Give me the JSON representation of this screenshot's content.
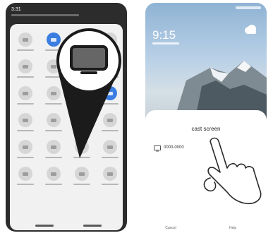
{
  "left_phone": {
    "status_time": "3:31",
    "tiles": [
      {
        "name": "tile-1"
      },
      {
        "name": "tile-2-active",
        "active": true
      },
      {
        "name": "tile-3"
      },
      {
        "name": "tile-4"
      },
      {
        "name": "tile-5"
      },
      {
        "name": "tile-6"
      },
      {
        "name": "tile-7"
      },
      {
        "name": "tile-8"
      },
      {
        "name": "tile-9"
      },
      {
        "name": "tile-10"
      },
      {
        "name": "tile-11"
      },
      {
        "name": "tile-12-active",
        "active": true
      },
      {
        "name": "tile-13"
      },
      {
        "name": "tile-14"
      },
      {
        "name": "tile-15"
      },
      {
        "name": "tile-16"
      },
      {
        "name": "tile-17"
      },
      {
        "name": "tile-18"
      },
      {
        "name": "cast-tile"
      },
      {
        "name": "tile-20"
      },
      {
        "name": "tile-21"
      },
      {
        "name": "tile-22"
      },
      {
        "name": "tile-23"
      },
      {
        "name": "tile-24"
      }
    ],
    "magnified_icon": "cast-screen-icon"
  },
  "right_phone": {
    "clock": "9:15",
    "weather_icon": "cloud-icon",
    "cast_sheet": {
      "title": "cast screen",
      "device_icon": "monitor-icon",
      "device_name": "0000-0000",
      "cancel_label": "Cancel",
      "help_label": "Help"
    },
    "gesture_icon": "tapping-hand-icon"
  },
  "colors": {
    "accent": "#3b7de0",
    "pointer": "#1b1b1b"
  }
}
